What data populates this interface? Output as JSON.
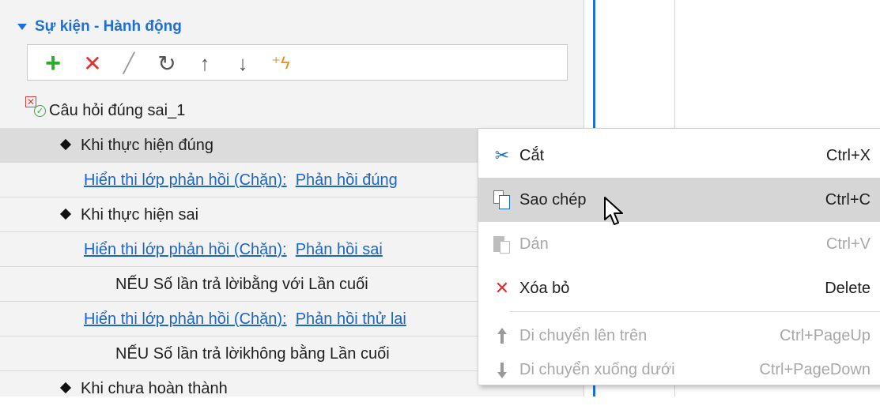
{
  "panel": {
    "title": "Sự kiện - Hành động",
    "toolbar": [
      "add-icon",
      "delete-icon",
      "edit-icon",
      "undo-icon",
      "move-up-icon",
      "move-down-icon",
      "magic-icon"
    ]
  },
  "tree": {
    "root": "Câu hỏi đúng sai_1",
    "rows": [
      {
        "kind": "event",
        "text": "Khi thực hiện đúng",
        "selected": true
      },
      {
        "kind": "action",
        "link": "Hiển thi lớp phản hồi (Chặn):",
        "target": "Phản hồi đúng"
      },
      {
        "kind": "event",
        "text": "Khi thực hiện sai"
      },
      {
        "kind": "action",
        "link": "Hiển thi lớp phản hồi (Chặn):",
        "target": "Phản hồi sai"
      },
      {
        "kind": "condition",
        "text": "NẾU Số lần trả lờibằng với Lần cuối"
      },
      {
        "kind": "action",
        "link": "Hiển thi lớp phản hồi (Chặn):",
        "target": "Phản hồi thử lai"
      },
      {
        "kind": "condition",
        "text": "NẾU Số lần trả lờikhông bằng Lần cuối"
      },
      {
        "kind": "event",
        "text": "Khi chưa hoàn thành"
      }
    ]
  },
  "menu": {
    "items": [
      {
        "label": "Cắt",
        "shortcut": "Ctrl+X",
        "icon": "scissors-icon",
        "disabled": false,
        "highlighted": false
      },
      {
        "label": "Sao chép",
        "shortcut": "Ctrl+C",
        "icon": "copy-icon",
        "disabled": false,
        "highlighted": true
      },
      {
        "label": "Dán",
        "shortcut": "Ctrl+V",
        "icon": "paste-icon",
        "disabled": true,
        "highlighted": false
      },
      {
        "label": "Xóa bỏ",
        "shortcut": "Delete",
        "icon": "delete-icon",
        "disabled": false,
        "highlighted": false
      },
      {
        "label": "Di chuyển lên trên",
        "shortcut": "Ctrl+PageUp",
        "icon": "arrow-up-icon",
        "disabled": true,
        "highlighted": false
      },
      {
        "label": "Di chuyển xuống dưới",
        "shortcut": "Ctrl+PageDown",
        "icon": "arrow-down-icon",
        "disabled": true,
        "highlighted": false
      }
    ]
  },
  "colors": {
    "accent": "#1e6fd9",
    "link": "#1a66c9",
    "add": "#2faa2f",
    "delete": "#e03030",
    "highlight": "#d6d6d6"
  }
}
